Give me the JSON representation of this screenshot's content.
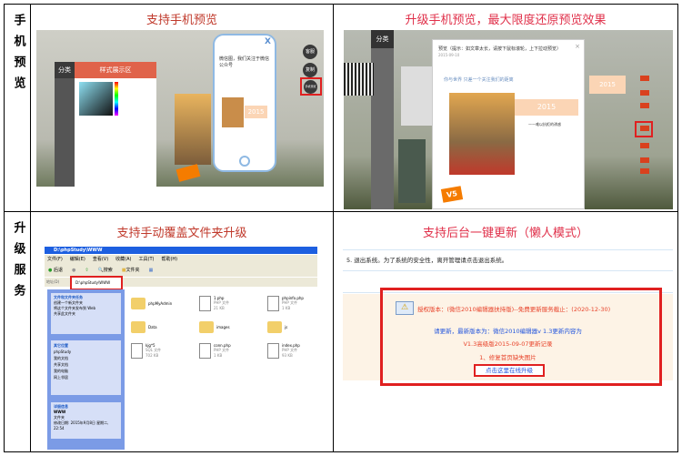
{
  "rows": [
    {
      "label": "手机预览",
      "left_title": "支持手机预览",
      "right_title": "升级手机预览，最大限度还原预览效果"
    },
    {
      "label": "升级服务",
      "left_title": "支持手动覆盖文件夹升级",
      "right_title": "支持后台一键更新（懒人模式）"
    }
  ],
  "preview1": {
    "category": "分类",
    "panel_title": "样式展示区",
    "phone_article": "微信图，我们关注于微信公众号",
    "year": "2015",
    "btn_1": "客服",
    "btn_2": "复制",
    "btn_3": "手机预览",
    "close": "X"
  },
  "preview2": {
    "dialog_title": "预览（提示：如文章太长，请按下鼠标滚轮，上下拉动预览）",
    "date": "2015-09-10",
    "category": "分类",
    "year": "2015",
    "caption": "——难以抗拒的诱惑",
    "badge": "V5",
    "banner": "你与世界 只差一个关注我们的距离",
    "close": "×"
  },
  "explorer": {
    "title": "D:\\phpStudy\\WWW",
    "menu": [
      "文件(F)",
      "编辑(E)",
      "查看(V)",
      "收藏(A)",
      "工具(T)",
      "帮助(H)"
    ],
    "toolbar": [
      "后退",
      "搜索",
      "文件夹"
    ],
    "address_label": "地址(D)",
    "address": "D:\\phpStudy\\WWW",
    "tasks_title": "文件和文件夹任务",
    "tasks": [
      "创建一个新文件夹",
      "将这个文件夹发布到 Web",
      "共享此文件夹"
    ],
    "places_title": "其它位置",
    "places": [
      "phpStudy",
      "我的文档",
      "共享文档",
      "我的电脑",
      "网上邻居"
    ],
    "details_title": "详细信息",
    "details": [
      "WWW",
      "文件夹",
      "修改日期: 2015年9月8日 星期二, 22:54"
    ],
    "files": [
      {
        "name": "phpMyAdmin",
        "type": "folder",
        "meta": ""
      },
      {
        "name": "1.php",
        "type": "php",
        "meta": "PHP 文件\n21 KB"
      },
      {
        "name": "phpinfo.php",
        "type": "php",
        "meta": "PHP 文件\n1 KB"
      },
      {
        "name": "Data",
        "type": "folder",
        "meta": ""
      },
      {
        "name": "images",
        "type": "folder",
        "meta": ""
      },
      {
        "name": "js",
        "type": "folder",
        "meta": ""
      },
      {
        "name": "kjg*5",
        "type": "sql",
        "meta": "SQL 文件\n702 KB"
      },
      {
        "name": "conn.php",
        "type": "php",
        "meta": "PHP 文件\n1 KB"
      },
      {
        "name": "index.php",
        "type": "php",
        "meta": "PHP 文件\n93 KB"
      }
    ]
  },
  "update": {
    "step": "5. 退出系统。为了系统的安全性，离开管理请点击退出系统。",
    "license": "授权版本：(微信2010编辑器扶持版)--免费更新服务截止：(2020-12-30)",
    "notice": "请更新，最新版本为：微信2010编辑器v 1.3更新内容为",
    "record": "V1.3高级版2015-09-07更新记录",
    "item": "1、修复首页缺失图片",
    "button": "点击这里在线升级"
  }
}
